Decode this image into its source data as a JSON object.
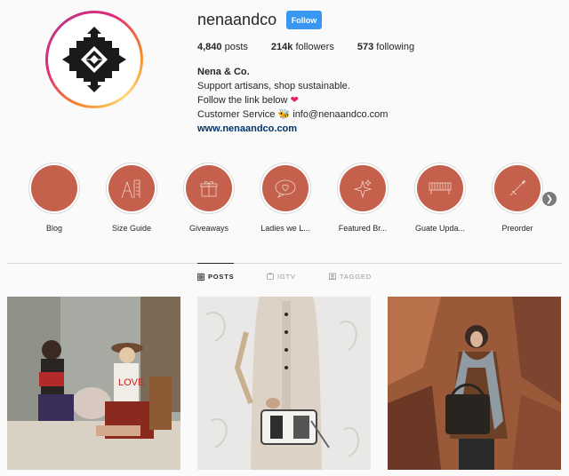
{
  "profile": {
    "username": "nenaandco",
    "follow_label": "Follow",
    "stats": {
      "posts_count": "4,840",
      "posts_label": "posts",
      "followers_count": "214k",
      "followers_label": "followers",
      "following_count": "573",
      "following_label": "following"
    },
    "bio": {
      "name": "Nena & Co.",
      "line1": "Support artisans, shop sustainable.",
      "line2": "Follow the link below",
      "line3_prefix": "Customer Service",
      "line3_email": "info@nenaandco.com",
      "website": "www.nenaandco.com"
    }
  },
  "highlights": [
    {
      "label": "Blog",
      "icon": "blank"
    },
    {
      "label": "Size Guide",
      "icon": "size-guide-icon"
    },
    {
      "label": "Giveaways",
      "icon": "gift-icon"
    },
    {
      "label": "Ladies we L...",
      "icon": "heart-speech-icon"
    },
    {
      "label": "Featured Br...",
      "icon": "sparkles-icon"
    },
    {
      "label": "Guate Upda...",
      "icon": "weaving-icon"
    },
    {
      "label": "Preorder",
      "icon": "needle-icon"
    }
  ],
  "tabs": [
    {
      "label": "POSTS",
      "icon": "grid-icon",
      "active": true
    },
    {
      "label": "IGTV",
      "icon": "tv-icon",
      "active": false
    },
    {
      "label": "TAGGED",
      "icon": "tag-icon",
      "active": false
    }
  ],
  "colors": {
    "accent": "#3897f0",
    "highlight_fill": "#c4604b",
    "link": "#003569"
  }
}
